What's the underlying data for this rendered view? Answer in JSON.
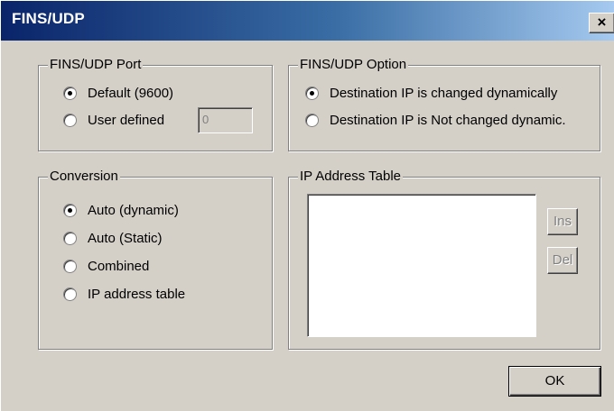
{
  "window": {
    "title": "FINS/UDP",
    "close_glyph": "×"
  },
  "port_group": {
    "legend": "FINS/UDP Port",
    "default_label": "Default (9600)",
    "user_label": "User defined",
    "user_value": "0",
    "selected": "default"
  },
  "option_group": {
    "legend": "FINS/UDP Option",
    "dynamic_label": "Destination IP is changed dynamically",
    "not_dynamic_label": "Destination IP is Not changed dynamic.",
    "selected": "dynamic"
  },
  "conversion_group": {
    "legend": "Conversion",
    "auto_dynamic_label": "Auto (dynamic)",
    "auto_static_label": "Auto (Static)",
    "combined_label": "Combined",
    "ip_table_label": "IP address table",
    "selected": "auto_dynamic"
  },
  "ip_table_group": {
    "legend": "IP Address Table",
    "ins_label": "Ins",
    "del_label": "Del",
    "entries": []
  },
  "ok_label": "OK"
}
